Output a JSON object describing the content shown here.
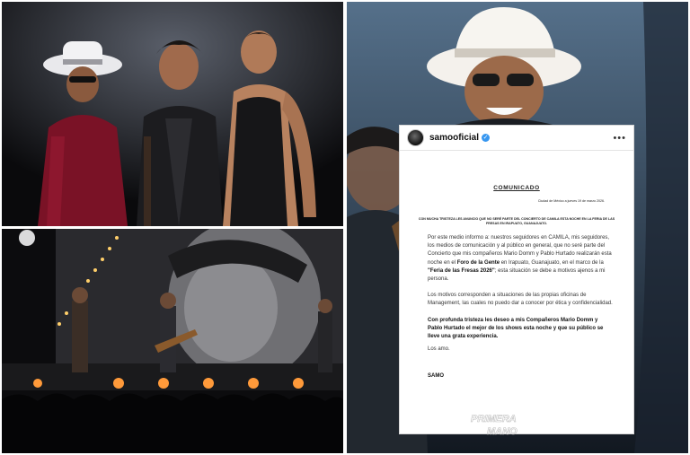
{
  "post": {
    "username": "samooficial",
    "verified_icon": "check",
    "title": "COMUNICADO",
    "dateline": "Ciudad de México a jueves 19 de marzo 2026.",
    "announcement": "CON MUCHA TRISTEZA LES ANUNCIO QUE NO SERÉ PARTE DEL CONCIERTO DE CAMILA ESTA NOCHE EN LA FERIA DE LAS FRESAS EN IRAPUATO, GUANAJUATO.",
    "p1_a": "Por este medio informo a: nuestros seguidores en CAMILA, mis seguidores, los medios de comunicación y al público en general, que no seré parte del Concierto que mis compañeros Mario Domm y Pablo Hurtado realizarán esta noche en el ",
    "p1_b": "Foro de la Gente",
    "p1_c": " en Irapuato, Guanajuato, en el marco de la ",
    "p1_d": "\"Feria de las Fresas 2026\"",
    "p1_e": "; esta situación se debe a motivos ajenos a mi persona.",
    "p2": "Los motivos corresponden a situaciones de las propias oficinas de Management, las cuales no puedo dar a conocer por ética y confidencialidad.",
    "p3": "Con profunda tristeza les deseo a mis Compañeros Mario Domm y Pablo Hurtado el mejor de los shows esta noche y que su público se lleve una grata experiencia.",
    "closing": "Los amo.",
    "signature": "SAMO"
  },
  "watermark": {
    "line1": "PRIMERA",
    "line2": "MANO"
  },
  "colors": {
    "verified": "#3797f0",
    "card_border": "#d8d8d8"
  }
}
